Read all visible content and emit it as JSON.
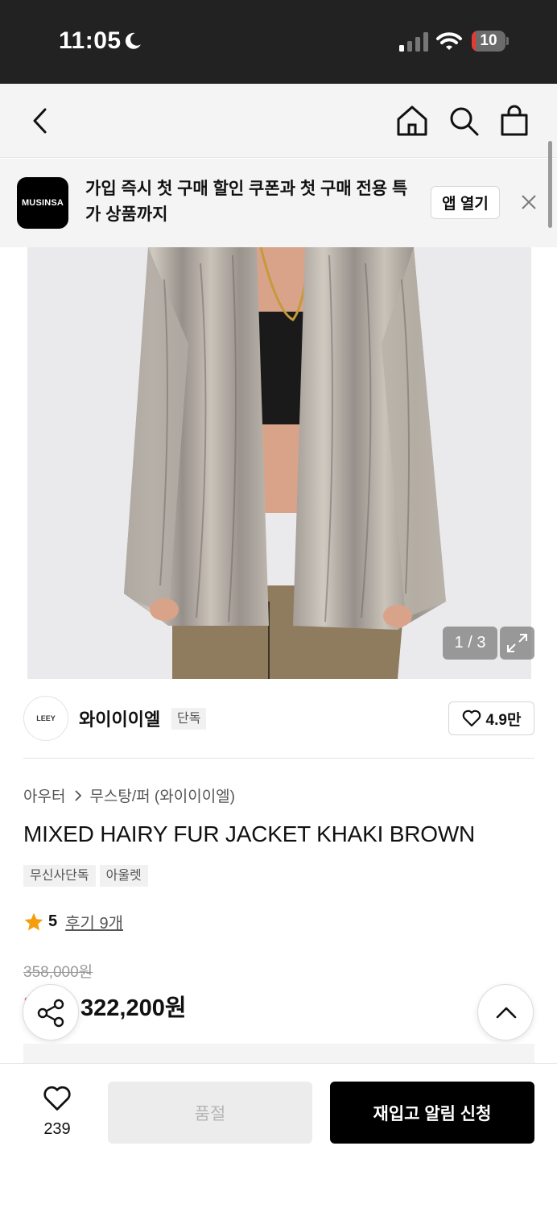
{
  "status_bar": {
    "time": "11:05",
    "battery_level": "10",
    "icons": [
      "moon-icon",
      "signal-icon",
      "wifi-icon",
      "battery-icon"
    ]
  },
  "nav": {
    "icons": [
      "back-icon",
      "home-icon",
      "search-icon",
      "shopping-bag-icon"
    ]
  },
  "banner": {
    "logo_text": "MUSINSA",
    "message": "가입 즉시 첫 구매 할인 쿠폰과 첫 구매 전용 특가 상품까지",
    "open_app_label": "앱 열기",
    "close_icon": "close-icon"
  },
  "gallery": {
    "counter": "1 / 3",
    "expand_icon": "expand-icon"
  },
  "brand": {
    "logo_text": "LEEY",
    "name": "와이이이엘",
    "badge": "단독",
    "likes": "4.9만"
  },
  "product": {
    "breadcrumb": [
      "아우터",
      "무스탕/퍼 (와이이이엘)"
    ],
    "title": "MIXED HAIRY FUR JACKET KHAKI BROWN",
    "tags": [
      "무신사단독",
      "아울렛"
    ],
    "rating": "5",
    "reviews": "후기 9개",
    "original_price": "358,000원",
    "sale_price": "322,200원",
    "discount_color": "#ff3b30",
    "rating_star_color": "#f59e0b"
  },
  "bottom_bar": {
    "wish_count": "239",
    "soldout_label": "품절",
    "restock_label": "재입고 알림 신청"
  }
}
